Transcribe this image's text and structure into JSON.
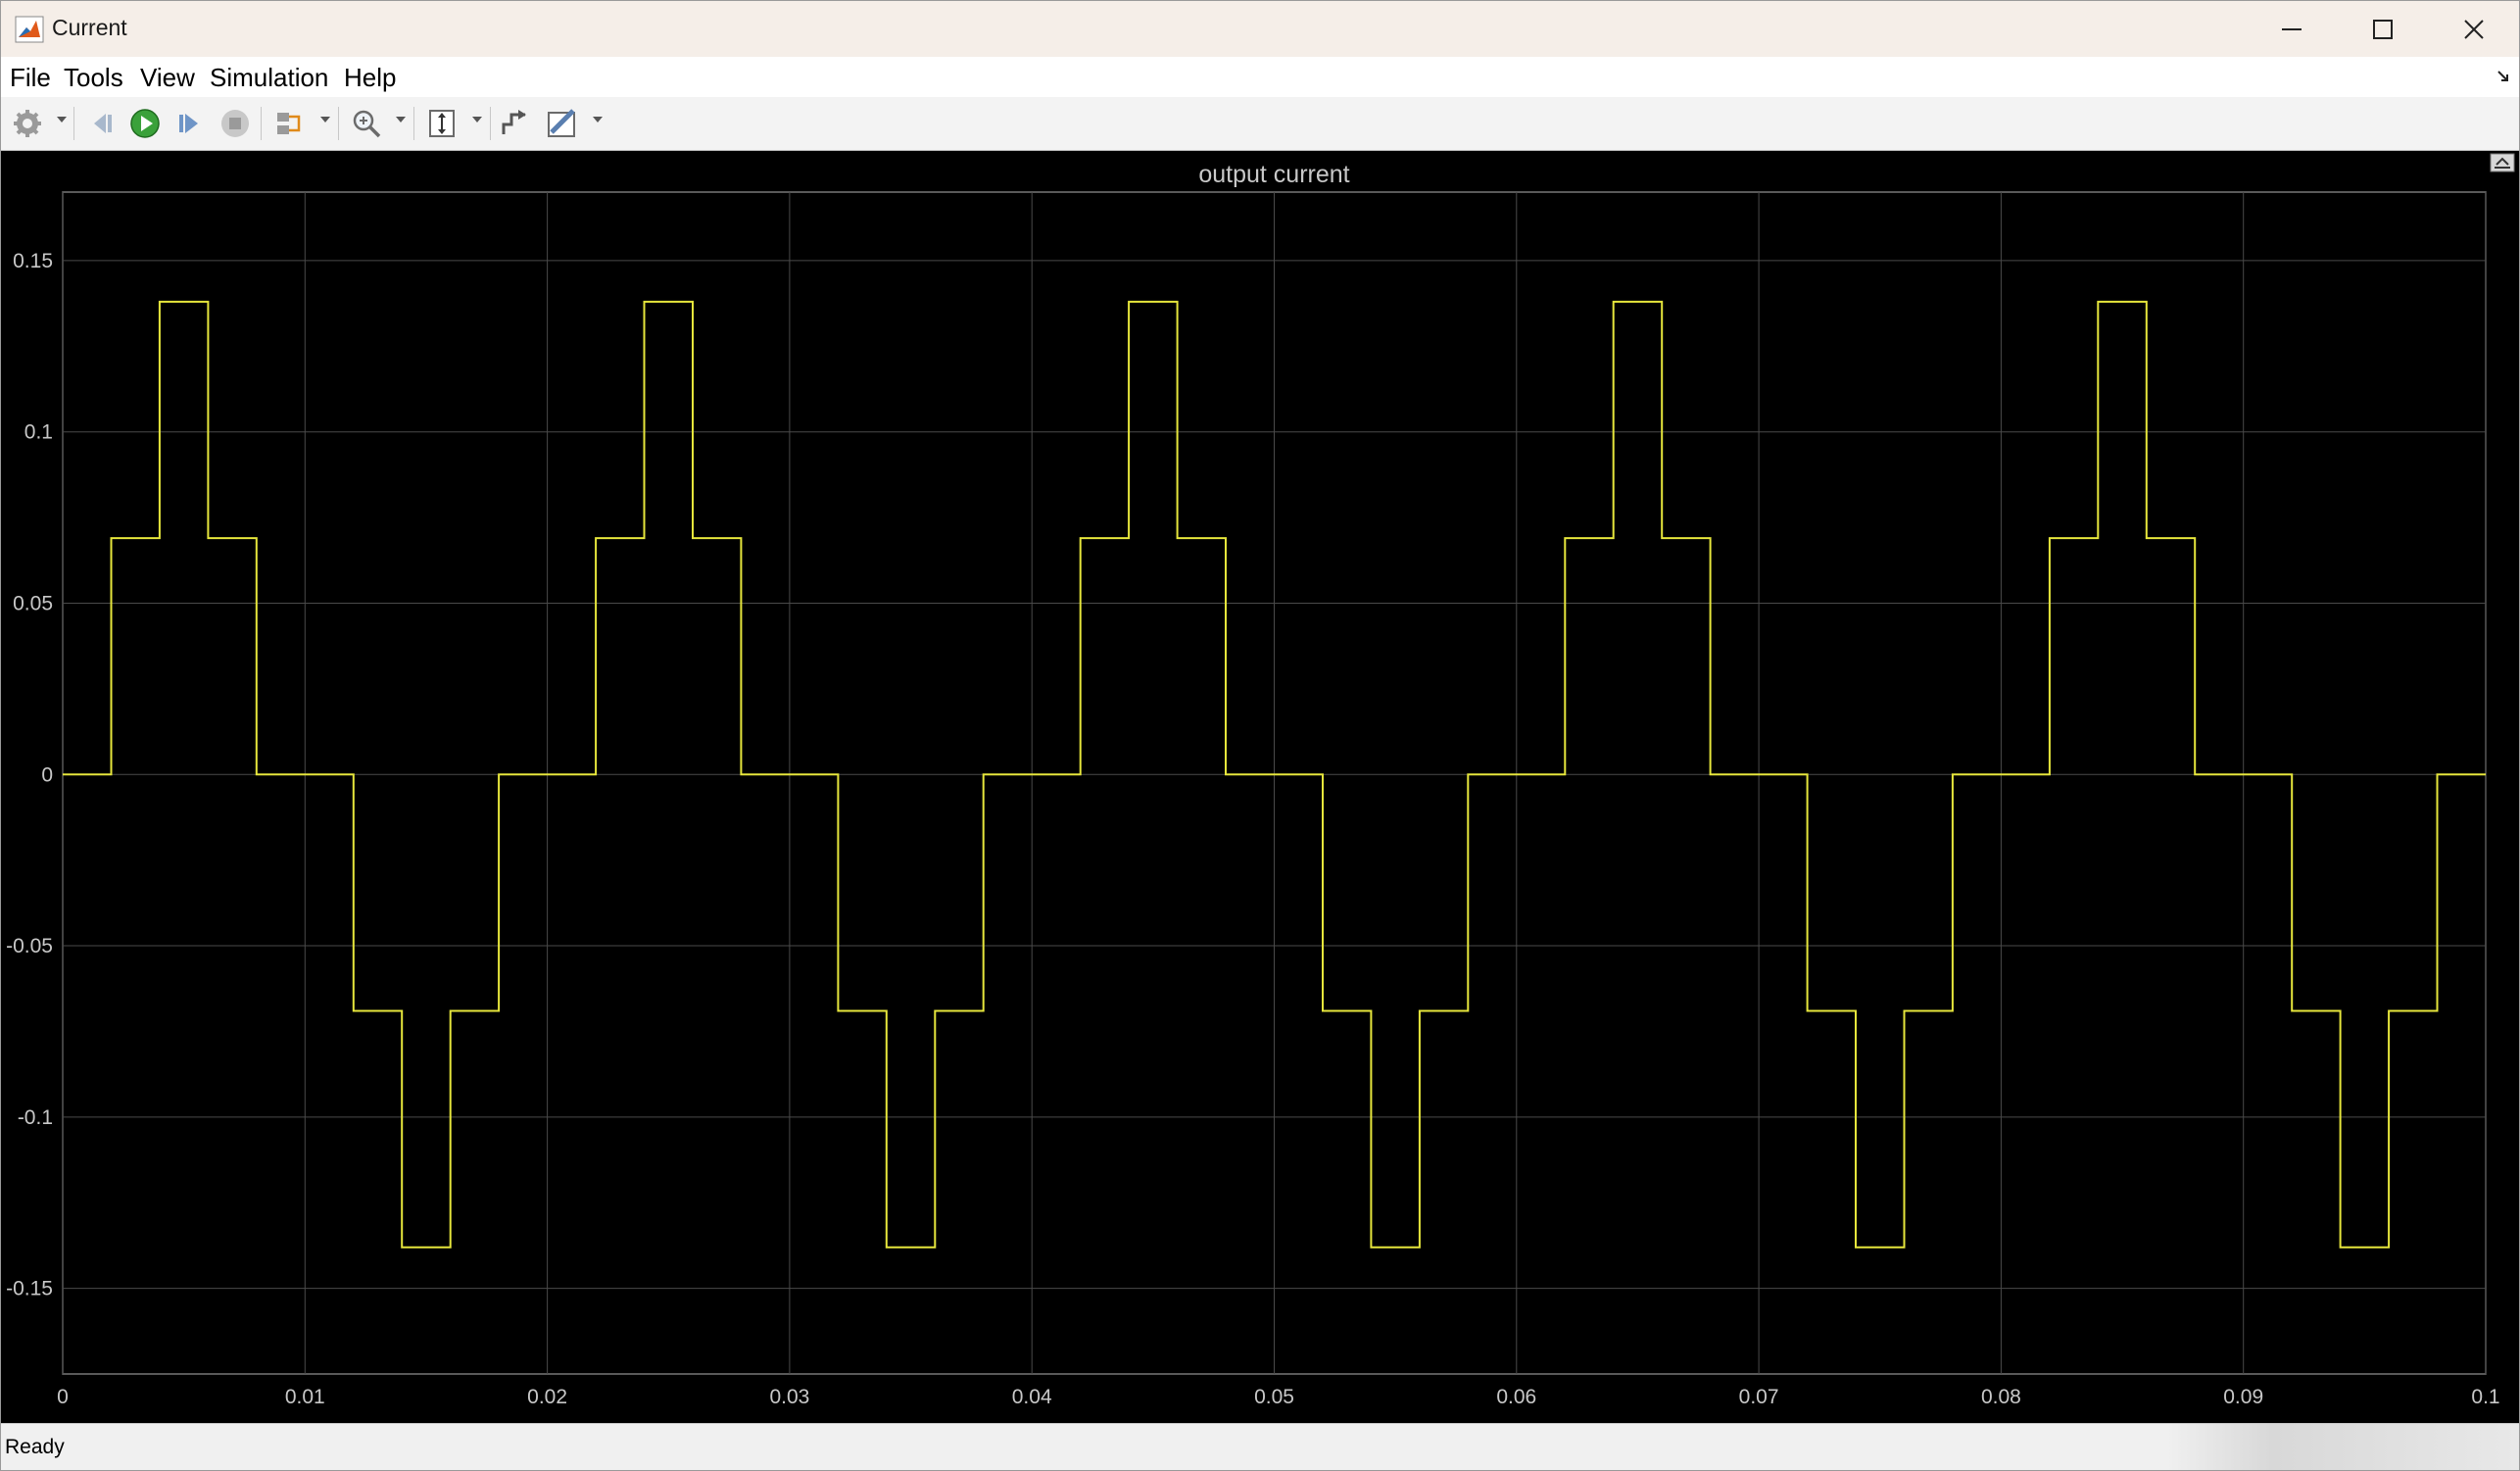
{
  "window": {
    "title": "Current"
  },
  "menu": {
    "file": "File",
    "tools": "Tools",
    "view": "View",
    "simulation": "Simulation",
    "help": "Help"
  },
  "toolbar": {
    "icons": [
      "settings-icon",
      "step-back-icon",
      "run-icon",
      "step-forward-icon",
      "stop-icon",
      "signal-select-icon",
      "zoom-icon",
      "scale-axes-icon",
      "triggers-icon",
      "measurements-icon"
    ]
  },
  "status": {
    "text": "Ready"
  },
  "colors": {
    "background": "#000000",
    "grid": "#4a4a4a",
    "axis_text": "#c8c8c8",
    "signal": "#e6e63c"
  },
  "chart_data": {
    "type": "line",
    "title": "output current",
    "xlabel": "",
    "ylabel": "",
    "xlim": [
      0,
      0.1
    ],
    "ylim": [
      -0.175,
      0.17
    ],
    "grid": true,
    "x_ticks": [
      "0",
      "0.01",
      "0.02",
      "0.03",
      "0.04",
      "0.05",
      "0.06",
      "0.07",
      "0.08",
      "0.09",
      "0.1"
    ],
    "y_ticks": [
      "0.15",
      "0.1",
      "0.05",
      "0",
      "-0.05",
      "-0.1",
      "-0.15"
    ],
    "y_tick_values": [
      0.15,
      0.1,
      0.05,
      0,
      -0.05,
      -0.1,
      -0.15
    ],
    "series": [
      {
        "style": "staircase",
        "period": 0.02,
        "levels_per_period": [
          [
            0.0,
            0
          ],
          [
            0.002,
            0.069
          ],
          [
            0.004,
            0.138
          ],
          [
            0.006,
            0.069
          ],
          [
            0.008,
            0
          ],
          [
            0.012,
            -0.069
          ],
          [
            0.014,
            -0.138
          ],
          [
            0.016,
            -0.069
          ],
          [
            0.018,
            0
          ]
        ]
      }
    ]
  }
}
